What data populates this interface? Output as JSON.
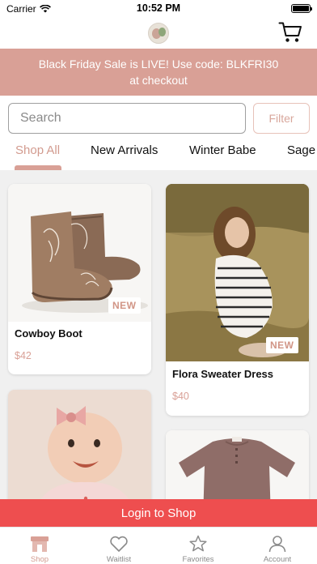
{
  "status_bar": {
    "carrier": "Carrier",
    "time": "10:52 PM"
  },
  "header": {
    "logo_icon": "brand-logo",
    "cart_icon": "cart-icon"
  },
  "promo": {
    "line1": "Black Friday Sale is LIVE! Use code: BLKFRI30",
    "line2": "at checkout"
  },
  "search": {
    "placeholder": "Search",
    "value": ""
  },
  "filter": {
    "label": "Filter"
  },
  "tabs": [
    {
      "label": "Shop All",
      "active": true
    },
    {
      "label": "New Arrivals"
    },
    {
      "label": "Winter Babe"
    },
    {
      "label": "Sage"
    }
  ],
  "products": [
    {
      "name": "Cowboy Boot",
      "price": "$42",
      "badge": "NEW"
    },
    {
      "name": "Flora Sweater Dress",
      "price": "$40",
      "badge": "NEW"
    },
    {
      "name": "",
      "price": ""
    },
    {
      "name": "",
      "price": ""
    }
  ],
  "login": {
    "label": "Login to Shop"
  },
  "tabbar": [
    {
      "label": "Shop",
      "icon": "shop-icon",
      "active": true
    },
    {
      "label": "Waitlist",
      "icon": "heart-icon"
    },
    {
      "label": "Favorites",
      "icon": "star-icon"
    },
    {
      "label": "Account",
      "icon": "account-icon"
    }
  ],
  "colors": {
    "accent": "#d9a096",
    "login_bar": "#ee4e4f"
  }
}
